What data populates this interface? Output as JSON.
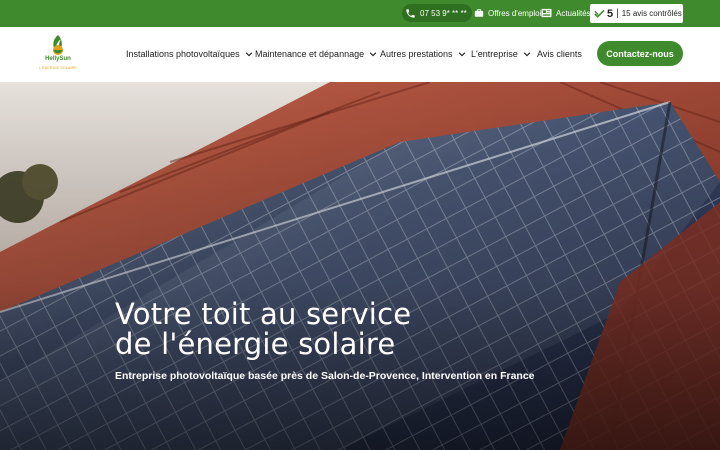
{
  "topbar": {
    "phone": "07 53 9* ** **",
    "jobs_label": "Offres d'emploi",
    "news_label": "Actualités",
    "review_score": "5",
    "review_separator": "|",
    "review_text": "15 avis contrôlés"
  },
  "header": {
    "logo_brand": "HellySun",
    "logo_tagline": "L'ÉNERGIE SOLAIRE",
    "nav": [
      {
        "label": "Installations photovoltaïques"
      },
      {
        "label": "Maintenance et dépannage"
      },
      {
        "label": "Autres prestations"
      },
      {
        "label": "L'entreprise"
      },
      {
        "label": "Avis clients"
      }
    ],
    "cta_label": "Contactez-nous"
  },
  "hero": {
    "title_line1": "Votre toit au service",
    "title_line2": "de l'énergie solaire",
    "subtitle": "Entreprise photovoltaïque basée près de Salon-de-Provence, Intervention en France"
  },
  "colors": {
    "brand_green": "#3f8a2c",
    "brand_green_dark": "#2f6f20",
    "logo_orange": "#e0a21a",
    "text_dark": "#1d1d1d"
  },
  "icons": [
    "phone-icon",
    "briefcase-icon",
    "newspaper-icon",
    "review-check-icon",
    "chevron-down-icon"
  ]
}
